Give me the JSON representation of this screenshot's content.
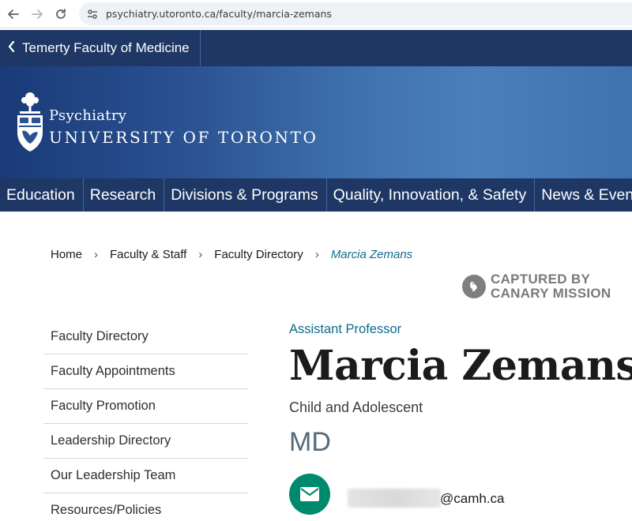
{
  "browser": {
    "url": "psychiatry.utoronto.ca/faculty/marcia-zemans"
  },
  "top_bar": {
    "back_label": "Temerty Faculty of Medicine"
  },
  "logo": {
    "department": "Psychiatry",
    "university": "UNIVERSITY OF TORONTO"
  },
  "main_nav": {
    "items": [
      "Education",
      "Research",
      "Divisions & Programs",
      "Quality, Innovation, & Safety",
      "News & Events"
    ]
  },
  "breadcrumb": {
    "items": [
      "Home",
      "Faculty & Staff",
      "Faculty Directory"
    ],
    "current": "Marcia Zemans",
    "separator": "›"
  },
  "watermark": {
    "line1": "CAPTURED BY",
    "line2": "CANARY MISSION"
  },
  "sidebar": {
    "items": [
      "Faculty Directory",
      "Faculty Appointments",
      "Faculty Promotion",
      "Leadership Directory",
      "Our Leadership Team",
      "Resources/Policies"
    ]
  },
  "profile": {
    "rank": "Assistant Professor",
    "name": "Marcia Zemans",
    "division": "Child and Adolescent",
    "degree": "MD",
    "email_domain": "@camh.ca"
  },
  "colors": {
    "navy": "#1e3765",
    "teal_link": "#0d6c8c",
    "email_green": "#008a6d"
  },
  "icons": {
    "back": "arrow-left-icon",
    "forward": "arrow-right-icon",
    "reload": "reload-icon",
    "site_info": "site-info-icon",
    "email": "envelope-icon",
    "watermark": "bird-icon"
  }
}
